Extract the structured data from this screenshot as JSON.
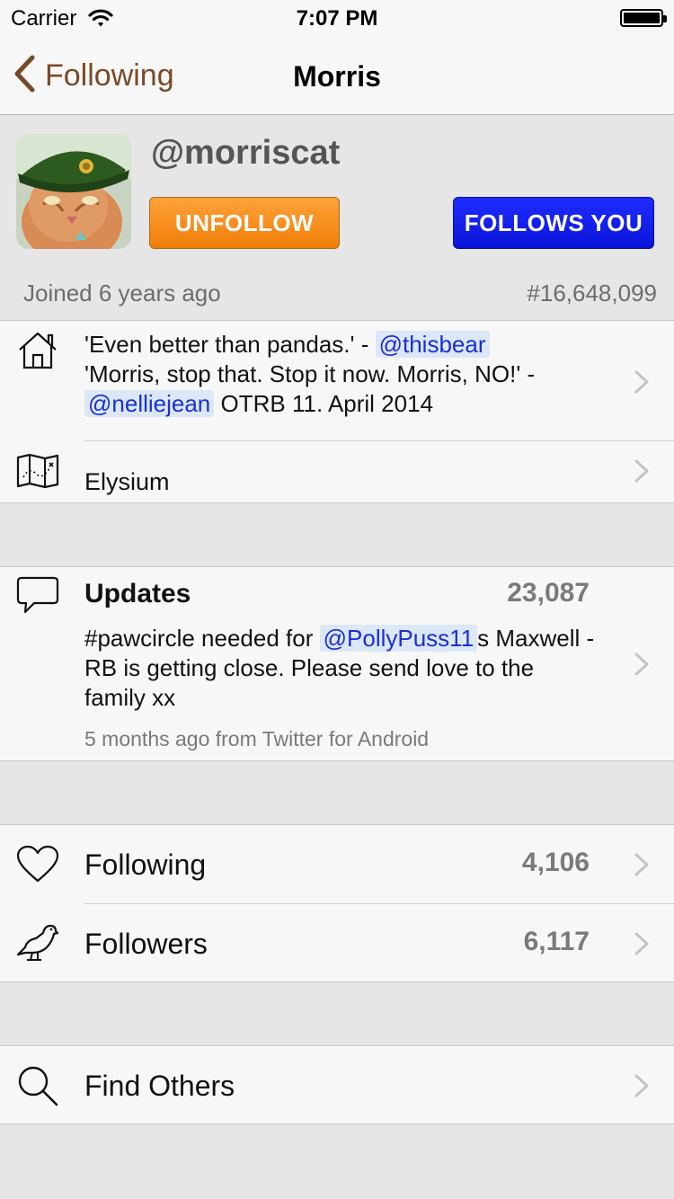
{
  "status_bar": {
    "carrier": "Carrier",
    "time": "7:07 PM",
    "battery_level": 1.0
  },
  "nav": {
    "back_label": "Following",
    "title": "Morris"
  },
  "profile": {
    "handle": "@morriscat",
    "unfollow_label": "UNFOLLOW",
    "follows_you_label": "FOLLOWS YOU",
    "joined": "Joined 6 years ago",
    "user_number": "#16,648,099"
  },
  "bio": {
    "part1": "'Even better than pandas.' -",
    "mention1": "@thisbear",
    "part2": "'Morris, stop that. Stop it now. Morris, NO!' -",
    "mention2": "@nelliejean",
    "part3": "OTRB 11. April 2014"
  },
  "location": "Elysium",
  "updates": {
    "title": "Updates",
    "count": "23,087",
    "text_before": "#pawcircle needed for",
    "mention": "@PollyPuss11",
    "text_after": "s Maxwell - RB is getting close. Please send love to the family xx",
    "meta": "5 months ago from Twitter for Android"
  },
  "following": {
    "label": "Following",
    "count": "4,106"
  },
  "followers": {
    "label": "Followers",
    "count": "6,117"
  },
  "find_others": {
    "label": "Find Others"
  },
  "icons": [
    "home-icon",
    "map-icon",
    "speech-bubble-icon",
    "heart-icon",
    "bird-icon",
    "search-icon",
    "chevron-right-icon",
    "chevron-left-icon",
    "wifi-icon",
    "battery-icon"
  ],
  "colors": {
    "accent": "#7a4a28",
    "unfollow": "#f5880f",
    "follows_you": "#1420f0",
    "mention_bg": "#dce7f7",
    "mention_text": "#1a2fd6"
  }
}
